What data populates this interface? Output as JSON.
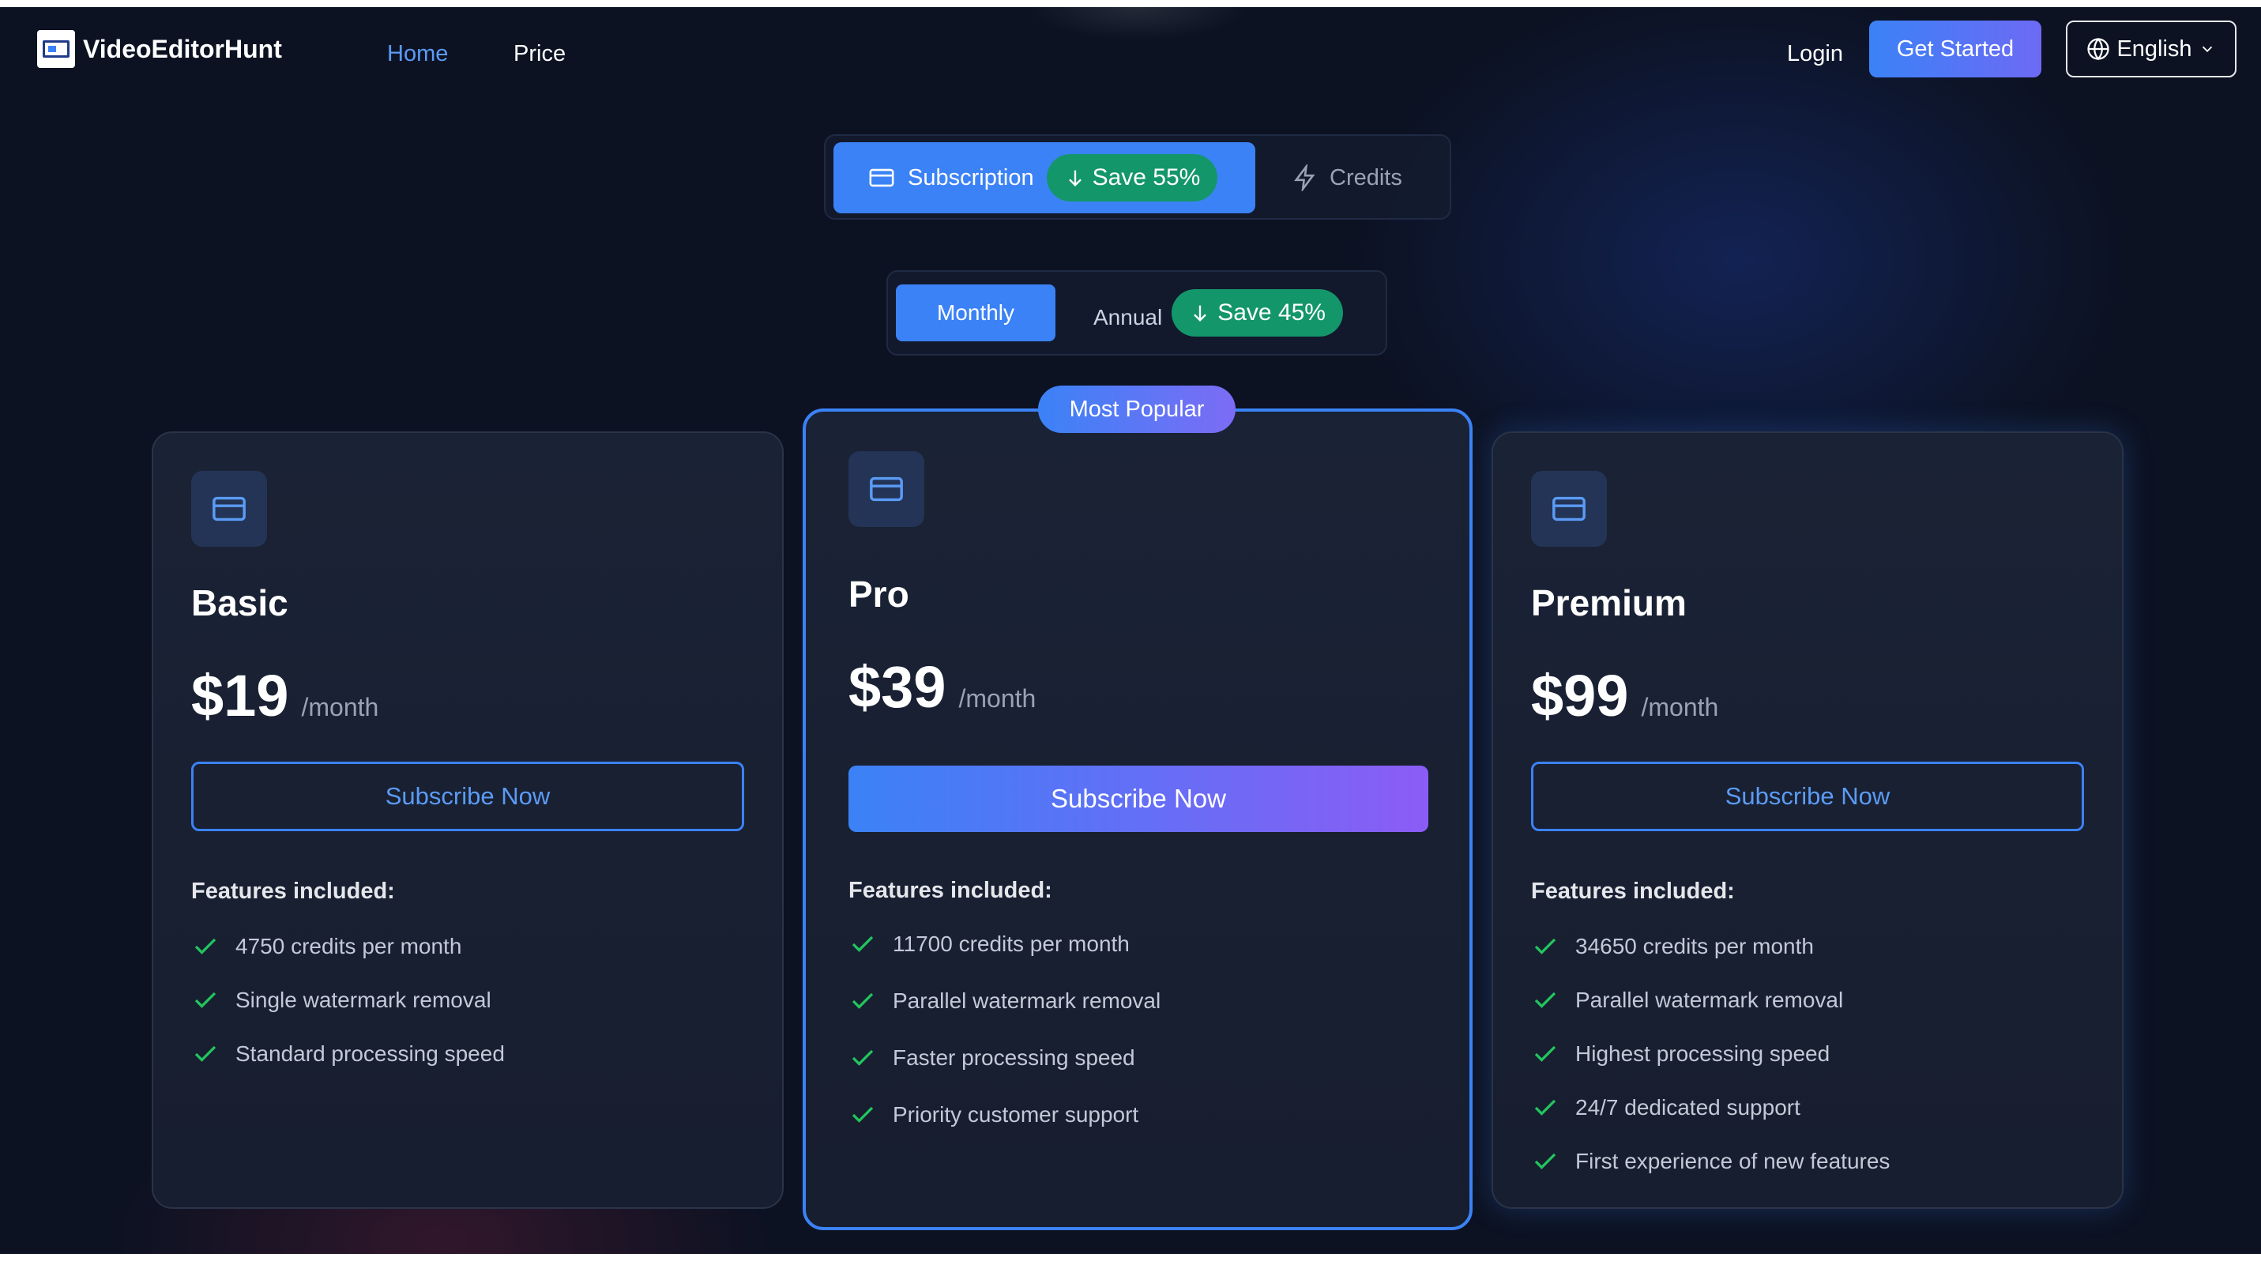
{
  "nav": {
    "brand": "VideoEditorHunt",
    "links": [
      {
        "label": "Home"
      },
      {
        "label": "Price"
      }
    ],
    "login": "Login",
    "get_started": "Get Started",
    "language": "English"
  },
  "plan_toggle": {
    "subscription": "Subscription",
    "subscription_save": "Save 55%",
    "credits": "Credits",
    "active": "Subscription"
  },
  "billing_toggle": {
    "monthly": "Monthly",
    "annual": "Annual",
    "annual_save": "Save 45%",
    "active": "Monthly"
  },
  "colors": {
    "accent": "#3b82f6",
    "accent_purple": "#8b5cf6",
    "save_green": "#14966b",
    "check_green": "#22c55e",
    "background": "#0c1222"
  },
  "plans": [
    {
      "name": "Basic",
      "price": "$19",
      "period": "/month",
      "cta": "Subscribe Now",
      "features_title": "Features included:",
      "features": [
        "4750 credits per month",
        "Single watermark removal",
        "Standard processing speed"
      ]
    },
    {
      "name": "Pro",
      "badge": "Most Popular",
      "price": "$39",
      "period": "/month",
      "cta": "Subscribe Now",
      "features_title": "Features included:",
      "features": [
        "11700 credits per month",
        "Parallel watermark removal",
        "Faster processing speed",
        "Priority customer support"
      ]
    },
    {
      "name": "Premium",
      "price": "$99",
      "period": "/month",
      "cta": "Subscribe Now",
      "features_title": "Features included:",
      "features": [
        "34650 credits per month",
        "Parallel watermark removal",
        "Highest processing speed",
        "24/7 dedicated support",
        "First experience of new features"
      ]
    }
  ],
  "icons": {
    "card": "credit-card-icon",
    "lightning": "lightning-icon",
    "arrow_down": "arrow-down-icon",
    "globe": "globe-icon",
    "chevron": "chevron-down-icon",
    "check": "check-icon"
  }
}
